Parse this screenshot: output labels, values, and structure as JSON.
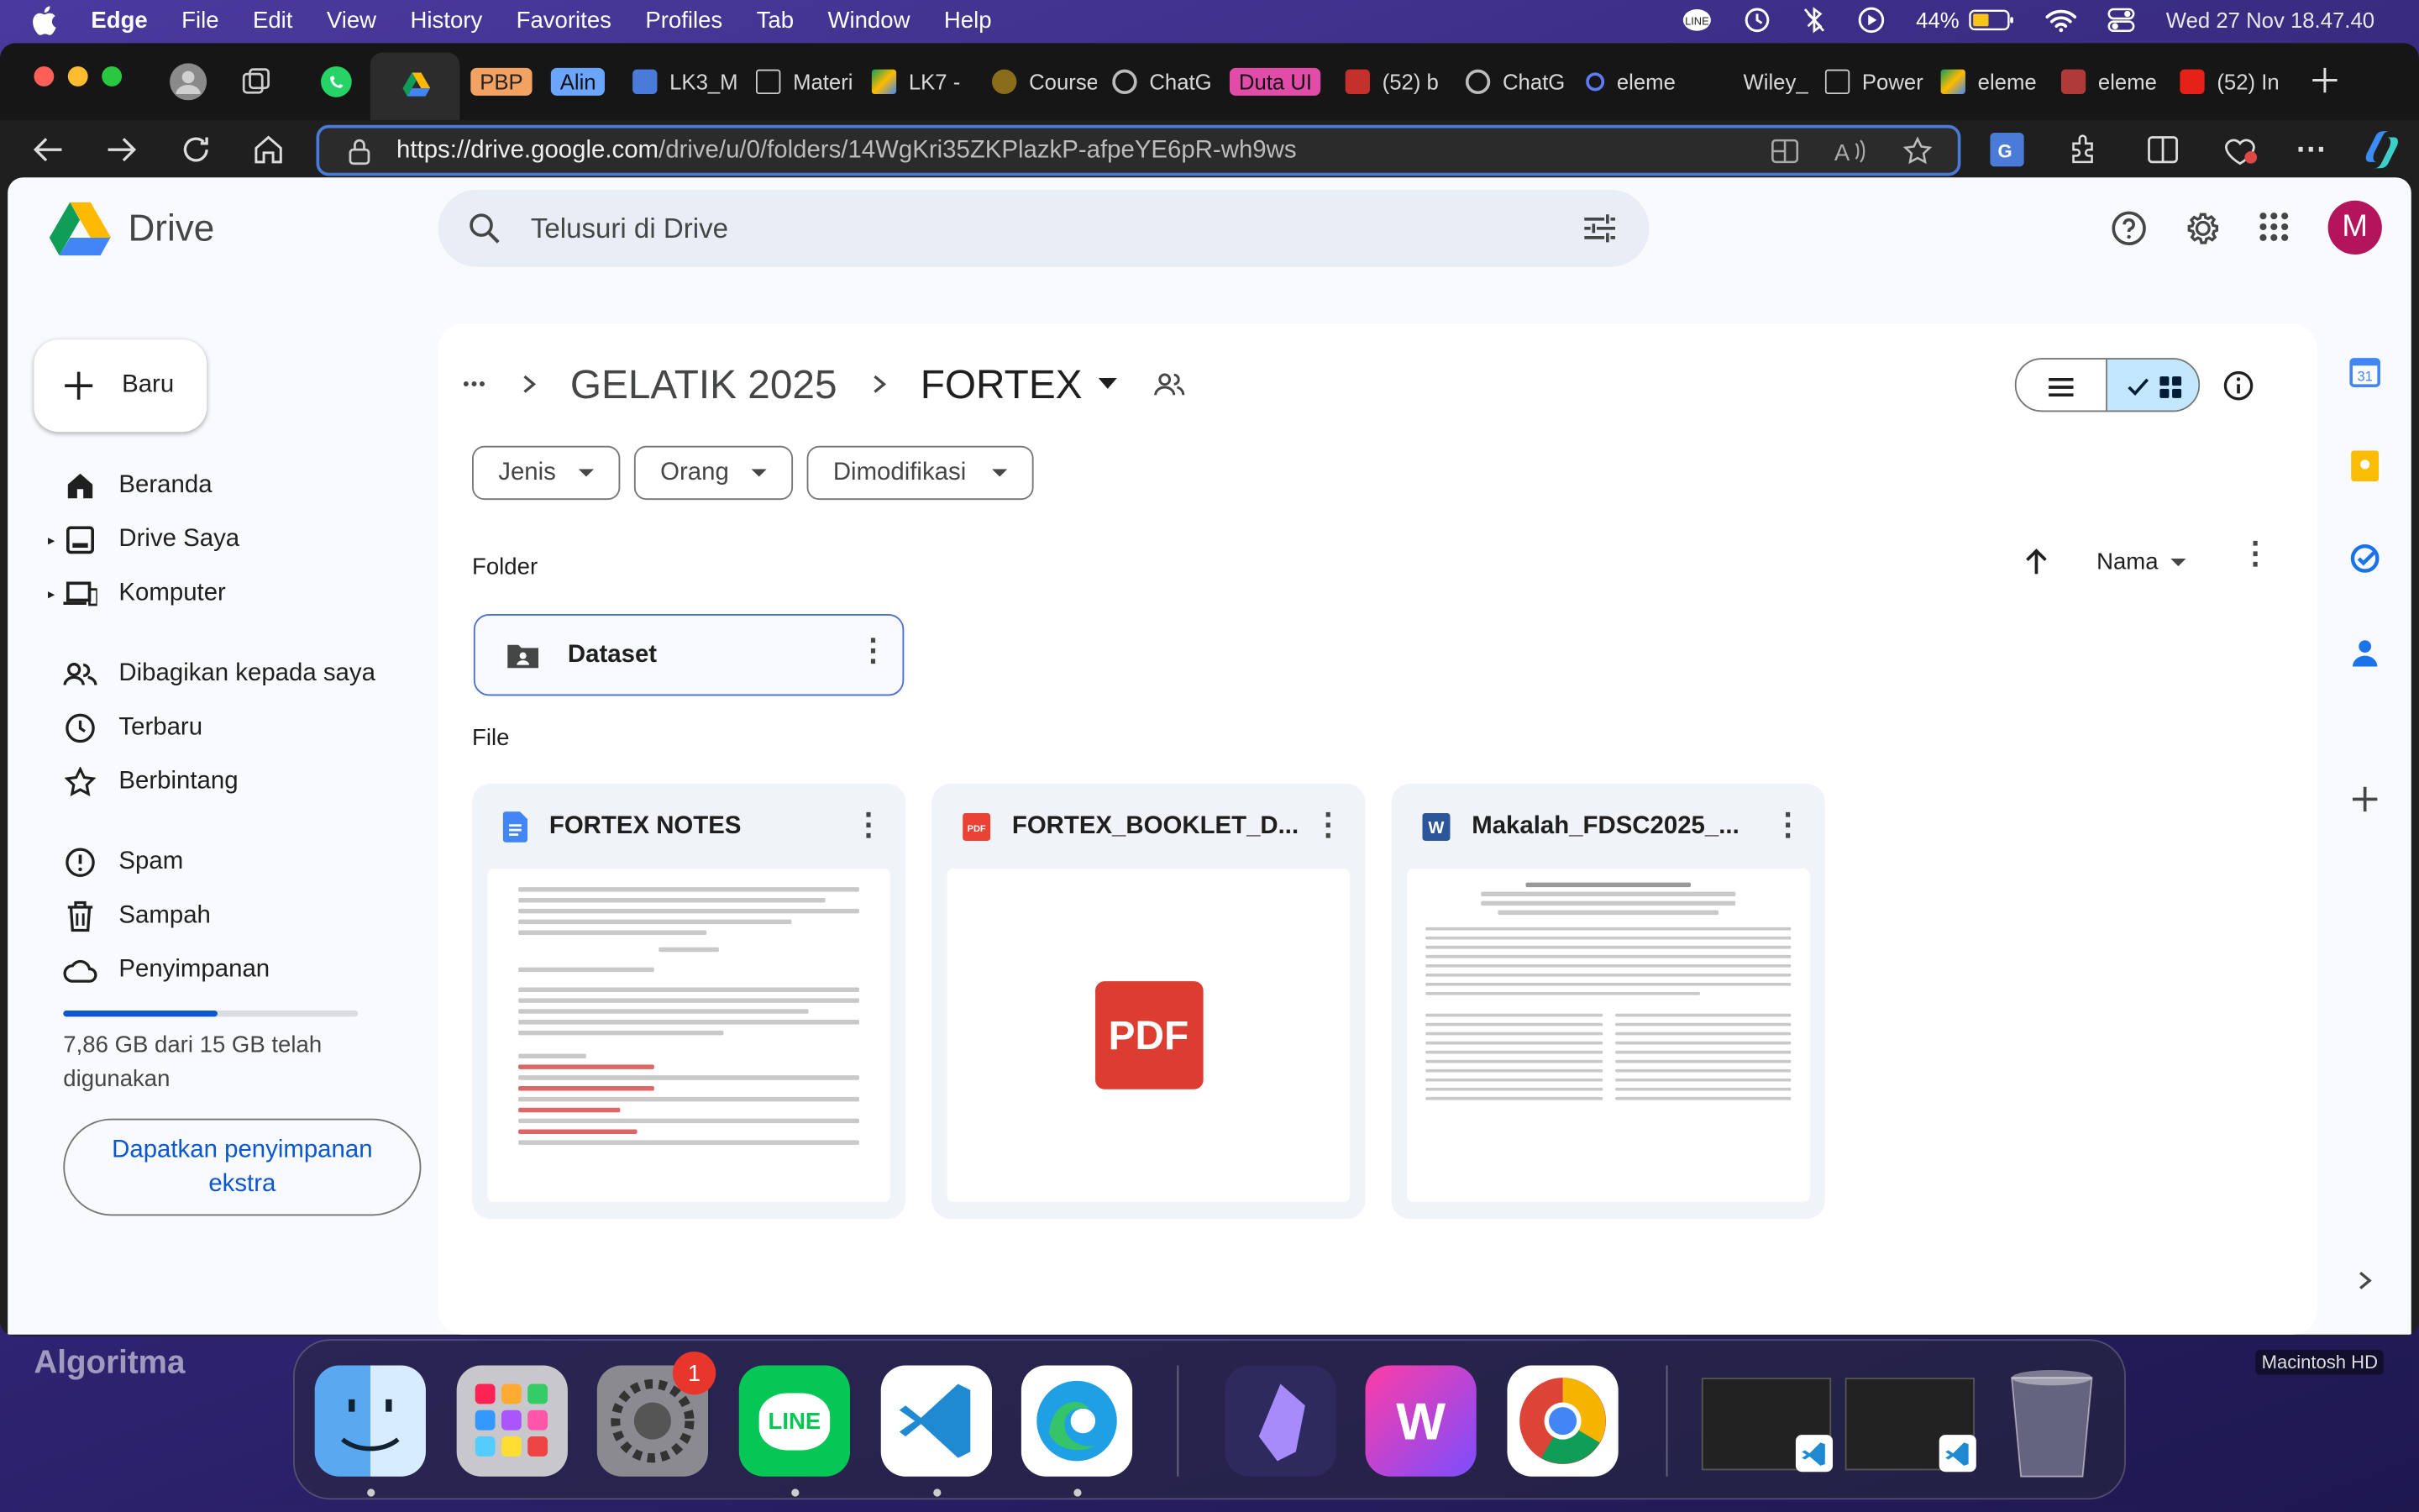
{
  "menubar": {
    "app_name": "Edge",
    "menus": [
      "File",
      "Edit",
      "View",
      "History",
      "Favorites",
      "Profiles",
      "Tab",
      "Window",
      "Help"
    ],
    "battery": "44%",
    "datetime": "Wed 27 Nov  18.47.40"
  },
  "tabs": [
    {
      "label": "PBP",
      "style": "badge",
      "color": "#f4a261"
    },
    {
      "label": "Alin",
      "style": "badge",
      "color": "#6aa5ff"
    },
    {
      "label": "LK3_M"
    },
    {
      "label": "Materi"
    },
    {
      "label": "LK7 -"
    },
    {
      "label": "Course"
    },
    {
      "label": "ChatG"
    },
    {
      "label": "Duta UI",
      "style": "badge",
      "color": "#e04ca8"
    },
    {
      "label": "(52) b"
    },
    {
      "label": "ChatG"
    },
    {
      "label": "eleme"
    },
    {
      "label": "Wiley_"
    },
    {
      "label": "Power"
    },
    {
      "label": "eleme"
    },
    {
      "label": "eleme"
    },
    {
      "label": "(52) In"
    }
  ],
  "address": {
    "url_host": "https://drive.google.com",
    "url_path": "/drive/u/0/folders/14WgKri35ZKPlazkP-afpeYE6pR-wh9ws"
  },
  "drive": {
    "logo_text": "Drive",
    "search_placeholder": "Telusuri di Drive",
    "new_button": "Baru",
    "avatar_letter": "M",
    "sidebar": {
      "nav1": [
        "Beranda",
        "Drive Saya",
        "Komputer"
      ],
      "nav2": [
        "Dibagikan kepada saya",
        "Terbaru",
        "Berbintang"
      ],
      "nav3": [
        "Spam",
        "Sampah",
        "Penyimpanan"
      ],
      "storage_text": "7,86 GB dari 15 GB telah digunakan",
      "storage_fraction": 0.524,
      "get_storage": "Dapatkan penyimpanan ekstra"
    },
    "breadcrumb": {
      "ellipsis": "•••",
      "parent": "GELATIK 2025",
      "current": "FORTEX"
    },
    "filters": [
      "Jenis",
      "Orang",
      "Dimodifikasi"
    ],
    "sort_label": "Nama",
    "folders_heading": "Folder",
    "folder_name": "Dataset",
    "files_heading": "File",
    "files": [
      {
        "name": "FORTEX NOTES",
        "kind": "doc"
      },
      {
        "name": "FORTEX_BOOKLET_D...",
        "kind": "pdf",
        "thumb_text": "PDF"
      },
      {
        "name": "Makalah_FDSC2025_...",
        "kind": "word"
      }
    ]
  },
  "desktop": {
    "wallpaper_text": "Algoritma",
    "hd_label": "Macintosh HD"
  },
  "dock": {
    "apps": [
      "Finder",
      "Launchpad",
      "System Settings",
      "LINE",
      "Visual Studio Code",
      "Microsoft Edge",
      "Obsidian",
      "Wondershare",
      "Google Chrome"
    ],
    "settings_badge": "1",
    "line_label": "LINE",
    "pdf_badge": "PDF"
  }
}
